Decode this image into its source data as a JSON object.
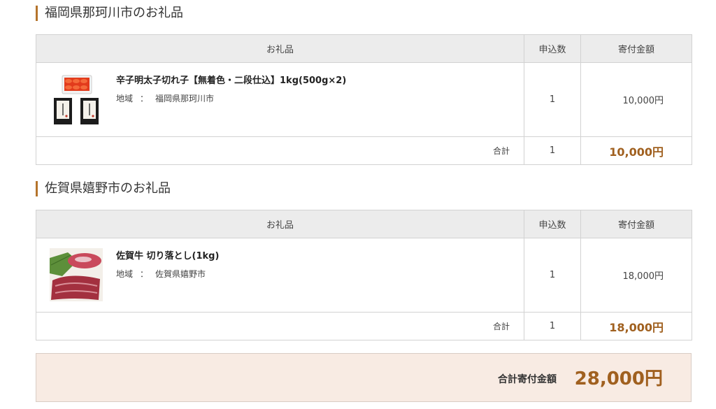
{
  "sections": [
    {
      "title": "福岡県那珂川市のお礼品",
      "headers": {
        "item": "お礼品",
        "quantity": "申込数",
        "amount": "寄付金額"
      },
      "item": {
        "name": "辛子明太子切れ子【無着色・二段仕込】1kg(500g×2)",
        "region_label": "地域",
        "region_sep": "：",
        "region": "福岡県那珂川市",
        "quantity": "1",
        "amount": "10,000円",
        "image": "mentaiko-package-image"
      },
      "subtotal": {
        "label": "合計",
        "quantity": "1",
        "amount": "10,000円"
      }
    },
    {
      "title": "佐賀県嬉野市のお礼品",
      "headers": {
        "item": "お礼品",
        "quantity": "申込数",
        "amount": "寄付金額"
      },
      "item": {
        "name": "佐賀牛 切り落とし(1kg)",
        "region_label": "地域",
        "region_sep": "：",
        "region": "佐賀県嬉野市",
        "quantity": "1",
        "amount": "18,000円",
        "image": "saga-beef-image"
      },
      "subtotal": {
        "label": "合計",
        "quantity": "1",
        "amount": "18,000円"
      }
    }
  ],
  "grand_total": {
    "label": "合計寄付金額",
    "amount": "28,000円"
  },
  "colors": {
    "accent": "#b5742c",
    "price": "#a0601f",
    "header_bg": "#ececec",
    "total_bg": "#f8ebe3"
  }
}
